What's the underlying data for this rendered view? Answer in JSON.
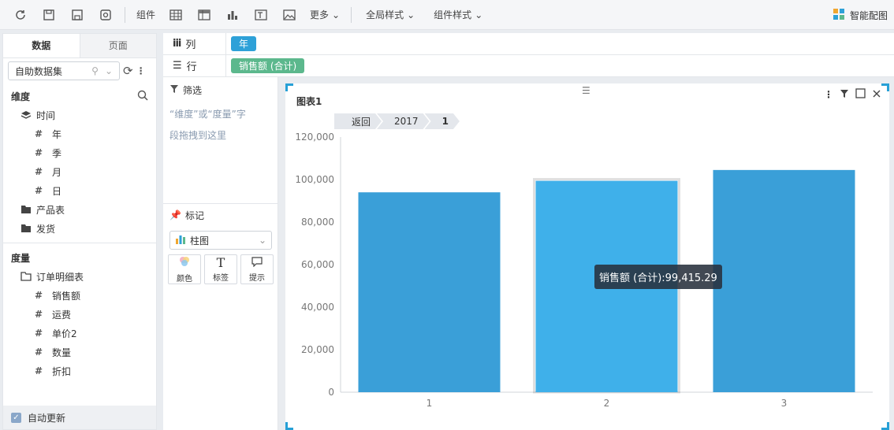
{
  "toolbar": {
    "component_label": "组件",
    "more_label": "更多",
    "global_style_label": "全局样式",
    "component_style_label": "组件样式",
    "smart_chart_label": "智能配图"
  },
  "left_panel": {
    "tabs": [
      "数据",
      "页面"
    ],
    "dataset_select": "自助数据集",
    "dimension_title": "维度",
    "dimension_items": [
      {
        "label": "时间",
        "icon": "layers-icon",
        "indent": 1
      },
      {
        "label": "年",
        "icon": "hash-icon",
        "indent": 2
      },
      {
        "label": "季",
        "icon": "hash-icon",
        "indent": 2
      },
      {
        "label": "月",
        "icon": "hash-icon",
        "indent": 2
      },
      {
        "label": "日",
        "icon": "hash-icon",
        "indent": 2
      },
      {
        "label": "产品表",
        "icon": "folder-icon",
        "indent": 1
      },
      {
        "label": "发货",
        "icon": "folder-icon",
        "indent": 1
      }
    ],
    "measure_title": "度量",
    "measure_items": [
      {
        "label": "订单明细表",
        "icon": "folder-open-icon",
        "indent": 1
      },
      {
        "label": "销售额",
        "icon": "hash-icon",
        "indent": 2
      },
      {
        "label": "运费",
        "icon": "hash-icon",
        "indent": 2
      },
      {
        "label": "单价2",
        "icon": "hash-icon",
        "indent": 2
      },
      {
        "label": "数量",
        "icon": "hash-icon",
        "indent": 2
      },
      {
        "label": "折扣",
        "icon": "hash-icon",
        "indent": 2
      }
    ],
    "auto_refresh": "自动更新"
  },
  "shelves": {
    "column_label": "列",
    "column_pill": "年",
    "row_label": "行",
    "row_pill": "销售额 (合计)"
  },
  "mid_panel": {
    "filter_title": "筛选",
    "filter_hint_1": "“维度”或“度量”字",
    "filter_hint_2": "段拖拽到这里",
    "mark_title": "标记",
    "chart_type": "柱图",
    "mark_buttons": [
      "颜色",
      "标签",
      "提示"
    ]
  },
  "chart": {
    "title": "图表1",
    "breadcrumbs": [
      "返回",
      "2017",
      "1"
    ],
    "tooltip": "销售额 (合计):99,415.29",
    "colors": {
      "bar": "#3a9fd8",
      "bar_highlight": "#3fb0ea"
    }
  },
  "chart_data": {
    "type": "bar",
    "title": "图表1",
    "categories": [
      "1",
      "2",
      "3"
    ],
    "series": [
      {
        "name": "销售额 (合计)",
        "values": [
          94000,
          99415.29,
          104500
        ]
      }
    ],
    "ylim": [
      0,
      120000
    ],
    "yticks": [
      "0",
      "20,000",
      "40,000",
      "60,000",
      "80,000",
      "100,000",
      "120,000"
    ],
    "highlight_index": 1,
    "grid": false
  }
}
